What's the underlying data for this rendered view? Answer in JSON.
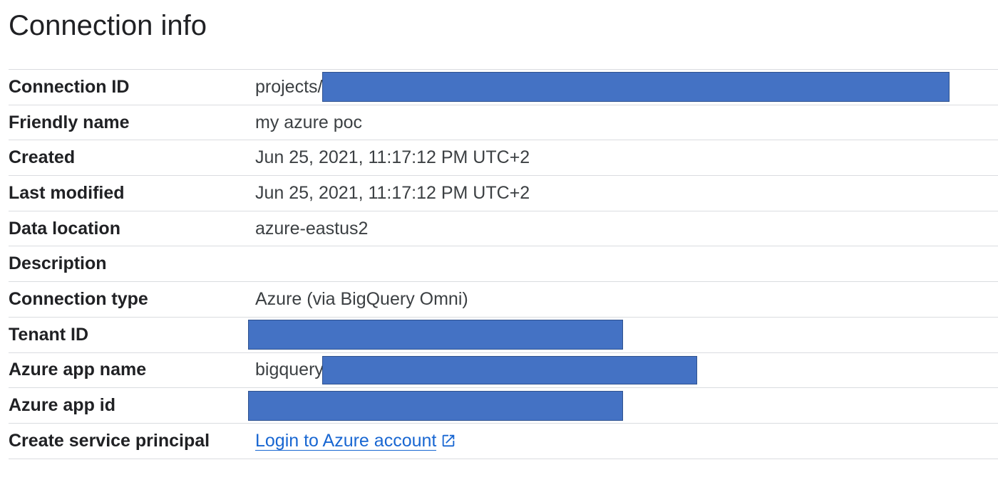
{
  "page": {
    "title": "Connection info"
  },
  "rows": [
    {
      "label": "Connection ID",
      "value_prefix": "projects/"
    },
    {
      "label": "Friendly name",
      "value": "my azure poc"
    },
    {
      "label": "Created",
      "value": "Jun 25, 2021, 11:17:12 PM UTC+2"
    },
    {
      "label": "Last modified",
      "value": "Jun 25, 2021, 11:17:12 PM UTC+2"
    },
    {
      "label": "Data location",
      "value": "azure-eastus2"
    },
    {
      "label": "Description",
      "value": ""
    },
    {
      "label": "Connection type",
      "value": "Azure (via BigQuery Omni)"
    },
    {
      "label": "Tenant ID"
    },
    {
      "label": "Azure app name",
      "value_prefix": "bigquery-"
    },
    {
      "label": "Azure app id"
    },
    {
      "label": "Create service principal",
      "link_text": "Login to Azure account"
    }
  ],
  "icons": {
    "external_link": "open-in-new-icon"
  },
  "colors": {
    "redaction": "#4472c4",
    "link": "#1967d2"
  }
}
